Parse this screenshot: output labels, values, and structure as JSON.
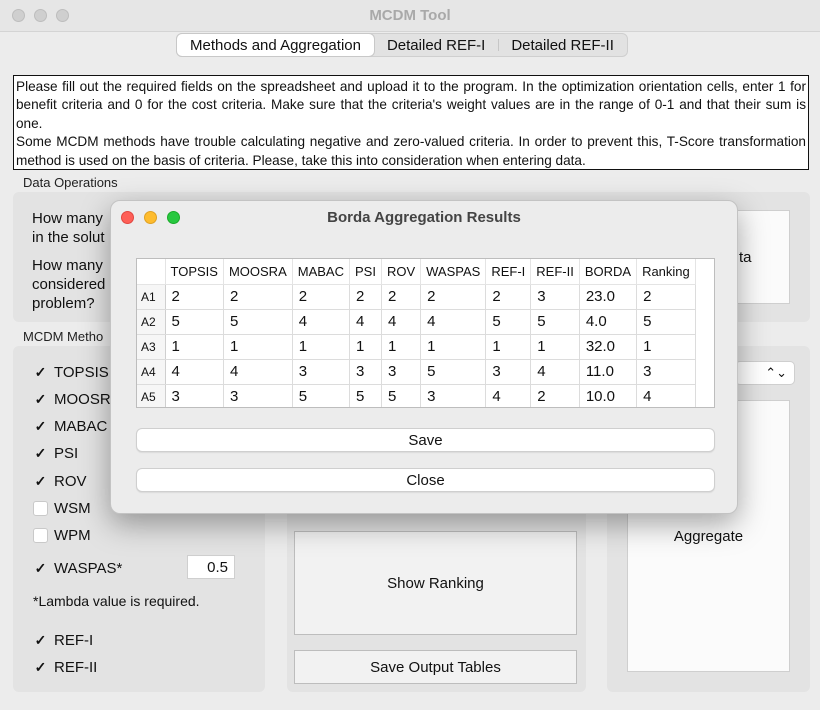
{
  "window": {
    "title": "MCDM Tool"
  },
  "tabs": [
    "Methods and Aggregation",
    "Detailed REF-I",
    "Detailed REF-II"
  ],
  "instructions": "Please fill out the required fields on the spreadsheet and upload it to the program. In the optimization orientation cells, enter 1 for benefit criteria and 0 for the cost criteria. Make sure that the criteria's weight values are in the range of 0-1 and that their sum is one. Some MCDM methods have trouble calculating negative and zero-valued criteria. In order to prevent this, T-Score transformation method is used on the basis of criteria. Please, take this into consideration when entering data.",
  "instructions_line1": "Please fill out the required fields on the spreadsheet and upload it to the program. In the optimization orientation cells, enter 1 for benefit criteria and 0 for the cost criteria. Make sure that the criteria's weight values are in the range of 0-1 and that their sum is one.",
  "instructions_line2": "Some MCDM methods have trouble calculating negative and zero-valued criteria. In order to prevent this, T-Score transformation method is used on the basis of criteria. Please, take this into consideration when entering data.",
  "data_operations": {
    "label": "Data Operations",
    "q1a": "How many",
    "q1b": "in the solut",
    "q2a": "How many",
    "q2b": "considered",
    "q2c": "problem?",
    "side_btn_fragment": "ta"
  },
  "methods": {
    "label": "MCDM Metho",
    "items": [
      {
        "label": "TOPSIS",
        "checked": true
      },
      {
        "label": "MOOSRA",
        "checked": true
      },
      {
        "label": "MABAC",
        "checked": true
      },
      {
        "label": "PSI",
        "checked": true
      },
      {
        "label": "ROV",
        "checked": true
      },
      {
        "label": "WSM",
        "checked": false
      },
      {
        "label": "WPM",
        "checked": false
      },
      {
        "label": "WASPAS*",
        "checked": true
      },
      {
        "label": "REF-I",
        "checked": true
      },
      {
        "label": "REF-II",
        "checked": true
      }
    ],
    "check_glyph": "✓",
    "lambda_value": "0.5",
    "lambda_note": "*Lambda value is required."
  },
  "buttons": {
    "show_ranking": "Show Ranking",
    "save_output": "Save Output Tables",
    "aggregate": "Aggregate"
  },
  "dialog": {
    "title": "Borda Aggregation Results",
    "columns": [
      "TOPSIS",
      "MOOSRA",
      "MABAC",
      "PSI",
      "ROV",
      "WASPAS",
      "REF-I",
      "REF-II",
      "BORDA",
      "Ranking"
    ],
    "rows": [
      {
        "id": "A1",
        "cells": [
          "2",
          "2",
          "2",
          "2",
          "2",
          "2",
          "2",
          "3",
          "23.0",
          "2"
        ]
      },
      {
        "id": "A2",
        "cells": [
          "5",
          "5",
          "4",
          "4",
          "4",
          "4",
          "5",
          "5",
          "4.0",
          "5"
        ]
      },
      {
        "id": "A3",
        "cells": [
          "1",
          "1",
          "1",
          "1",
          "1",
          "1",
          "1",
          "1",
          "32.0",
          "1"
        ]
      },
      {
        "id": "A4",
        "cells": [
          "4",
          "4",
          "3",
          "3",
          "3",
          "5",
          "3",
          "4",
          "11.0",
          "3"
        ]
      },
      {
        "id": "A5",
        "cells": [
          "3",
          "3",
          "5",
          "5",
          "5",
          "3",
          "4",
          "2",
          "10.0",
          "4"
        ]
      }
    ],
    "save_label": "Save",
    "close_label": "Close"
  }
}
